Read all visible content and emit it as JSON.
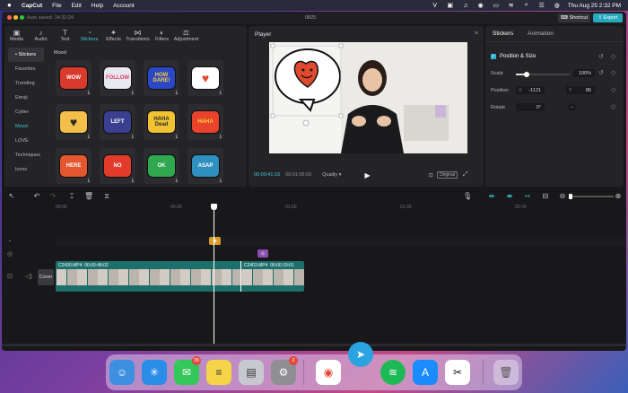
{
  "menubar": {
    "app": "CapCut",
    "items": [
      "File",
      "Edit",
      "Help",
      "Account"
    ],
    "clock": "Thu Aug 25  2:32 PM"
  },
  "window": {
    "autosave": "Auto saved: 14:32:24",
    "project": "0825",
    "shortcut_label": "Shortcut",
    "export_label": "Export"
  },
  "tools": [
    {
      "label": "Media",
      "icon": "media-icon"
    },
    {
      "label": "Audio",
      "icon": "audio-icon"
    },
    {
      "label": "Text",
      "icon": "text-icon"
    },
    {
      "label": "Stickers",
      "icon": "stickers-icon",
      "active": true
    },
    {
      "label": "Effects",
      "icon": "effects-icon"
    },
    {
      "label": "Transitions",
      "icon": "transitions-icon"
    },
    {
      "label": "Filters",
      "icon": "filters-icon"
    },
    {
      "label": "Adjustment",
      "icon": "adjustment-icon"
    }
  ],
  "categories": [
    "• Stickers",
    "Favorites",
    "Trending",
    "Emoji",
    "Cyber",
    "Mood",
    "LOVE",
    "Techniques",
    "Icons"
  ],
  "category_title": "Mood",
  "stickers": [
    {
      "text": "WOW",
      "bg": "#d93a2b",
      "fg": "#ffffff"
    },
    {
      "text": "FOLLOW",
      "bg": "#e8e8ef",
      "fg": "#e23c6a"
    },
    {
      "text": "HOW DARE!",
      "bg": "#2b47c6",
      "fg": "#ffd236"
    },
    {
      "text": "",
      "bg": "#ffffff",
      "fg": "#e04a2e"
    },
    {
      "text": "",
      "bg": "#f2c04a",
      "fg": "#2a2a2a"
    },
    {
      "text": "LEFT",
      "bg": "#3a3f8f",
      "fg": "#ffffff"
    },
    {
      "text": "HAHA Dead",
      "bg": "#f1c232",
      "fg": "#2a2a2a"
    },
    {
      "text": "HAHA",
      "bg": "#e9422d",
      "fg": "#ffd236"
    },
    {
      "text": "HERE",
      "bg": "#e4572e",
      "fg": "#ffffff"
    },
    {
      "text": "NO",
      "bg": "#e23b2b",
      "fg": "#ffffff"
    },
    {
      "text": "OK",
      "bg": "#2fa84f",
      "fg": "#ffffff"
    },
    {
      "text": "ASAP",
      "bg": "#2f8fbf",
      "fg": "#ffffff"
    }
  ],
  "player": {
    "title": "Player",
    "current_time": "00:00:41:18",
    "total_time": "00:01:05:03",
    "quality": "Quality",
    "original": "Original"
  },
  "inspector": {
    "tabs": [
      "Stickers",
      "Animation"
    ],
    "section": "Position & Size",
    "scale_label": "Scale",
    "scale_value": "100%",
    "scale_level": 0.2,
    "position_label": "Position",
    "x_label": "X",
    "x_value": "-1121",
    "y_label": "Y",
    "y_value": "86",
    "rotate_label": "Rotate",
    "rotate_value": "0°"
  },
  "timeline": {
    "ruler": [
      "00:00",
      "00:30",
      "01:00",
      "01:30",
      "02:00"
    ],
    "cover_label": "Cover",
    "clip1_name": "C2430.MP4",
    "clip1_dur": "00:00:48:02",
    "clip2_name": "C2403.MP4",
    "clip2_dur": "00:00:19:01"
  },
  "dock": {
    "messages_badge": "35",
    "settings_badge": "2"
  }
}
